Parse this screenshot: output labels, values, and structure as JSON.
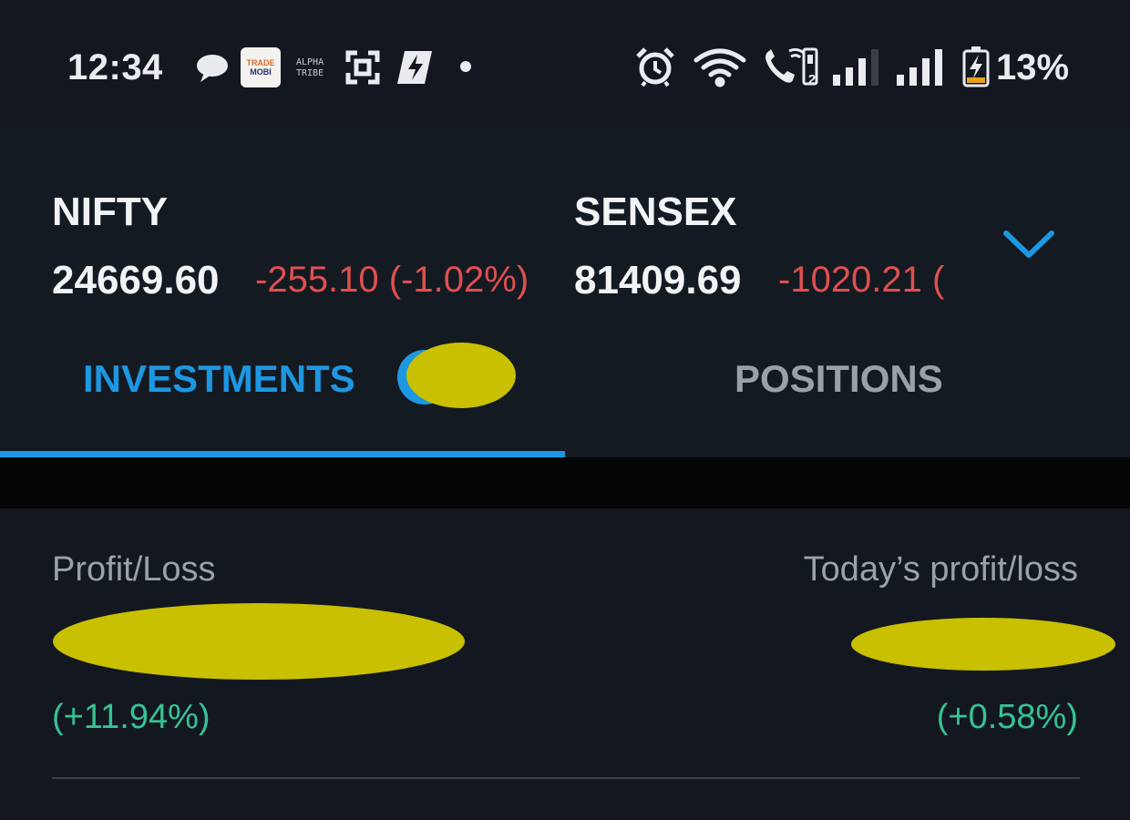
{
  "status_bar": {
    "time": "12:34",
    "app_logo_line1": "TRADE",
    "app_logo_line2": "MOBI",
    "alpha_line1": "ALPHA",
    "alpha_line2": "TRIBE",
    "battery_percent": "13%",
    "sim_slot": "2",
    "icons": [
      "chat-bubble-icon",
      "trademobi-app-icon",
      "alphatribe-app-icon",
      "scan-icon",
      "lightning-app-icon",
      "notification-dot",
      "alarm-icon",
      "wifi-icon",
      "wifi-calling-icon",
      "signal-sim1-icon",
      "signal-sim2-icon",
      "battery-charging-icon"
    ]
  },
  "indices": [
    {
      "name": "NIFTY",
      "value": "24669.60",
      "change": "-255.10 (-1.02%)"
    },
    {
      "name": "SENSEX",
      "value": "81409.69",
      "change": "-1020.21 ("
    }
  ],
  "tabs": {
    "investments": "INVESTMENTS",
    "positions": "POSITIONS",
    "active": "investments"
  },
  "pnl": {
    "total_label": "Profit/Loss",
    "total_pct": "(+11.94%)",
    "today_label": "Today’s profit/loss",
    "today_pct": "(+0.58%)"
  },
  "colors": {
    "accent": "#1e97e2",
    "negative": "#e04f50",
    "positive": "#37c293",
    "redaction": "#c8c000",
    "background": "#131820"
  }
}
